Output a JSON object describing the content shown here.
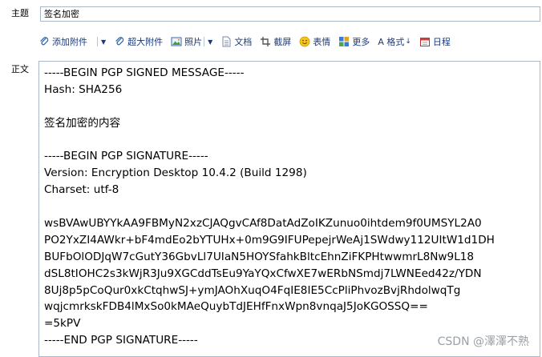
{
  "subject": {
    "label": "主题",
    "value": "签名加密"
  },
  "toolbar": {
    "attach": "添加附件",
    "big_attach": "超大附件",
    "photo": "照片",
    "doc": "文档",
    "screenshot": "截屏",
    "emoji": "表情",
    "more": "更多",
    "format": "A 格式",
    "calendar": "日程"
  },
  "body": {
    "label": "正文",
    "lines": [
      "-----BEGIN PGP SIGNED MESSAGE-----",
      "Hash: SHA256",
      "",
      "签名加密的内容",
      "",
      "-----BEGIN PGP SIGNATURE-----",
      "Version: Encryption Desktop 10.4.2 (Build 1298)",
      "Charset: utf-8",
      "",
      "wsBVAwUBYYkAA9FBMyN2xzCJAQgvCAf8DatAdZoIKZunuo0ihtdem9f0UMSYL2A0",
      "PO2YxZI4AWkr+bF4mdEo2bYTUHx+0m9G9IFUPepejrWeAj1SWdwy112UItW1d1DH",
      "BUFbOlODJqW7cGutY36GbvLl7UIaN5HOYSfahkBltcEhnZiFKPHtwwmrL8Nw9L18",
      "dSL8tIOHC2s3kWjR3Ju9XGCddTsEu9YaYQxCfwXE7wERbNSmdj7LWNEed42z/YDN",
      "8Uj8p5pCoQur0xkCtqhwSJ+ymJAOhXuqO4FqIE8IE5CcPliPhvozBvjRhdolwqTg",
      "wqjcmrkskFDB4lMxSo0kMAeQuybTdJEHfFnxWpn8vnqaJ5JoKGOSSQ==",
      "=5kPV",
      "-----END PGP SIGNATURE-----"
    ]
  },
  "watermark": "CSDN @澤澤不熟"
}
